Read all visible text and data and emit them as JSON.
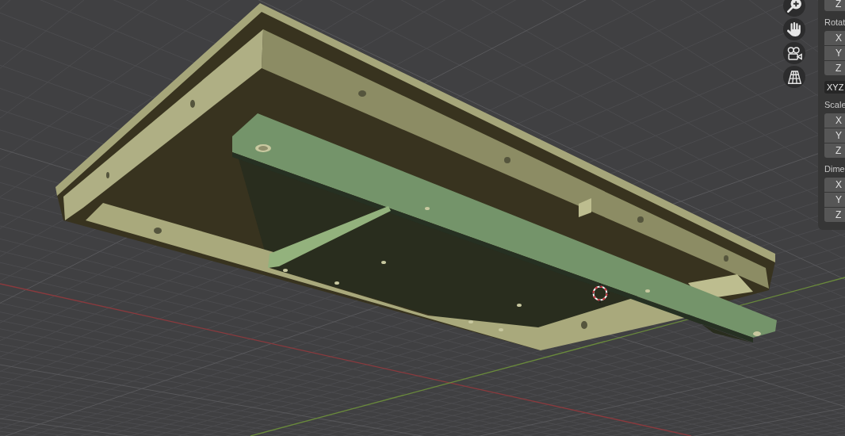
{
  "sidebar": {
    "location_tail": [
      {
        "label": "Z"
      }
    ],
    "groups": [
      {
        "heading": "Rotat",
        "fields": [
          {
            "label": "X"
          },
          {
            "label": "Y"
          },
          {
            "label": "Z"
          }
        ],
        "mode_dropdown": "XYZ"
      },
      {
        "heading": "Scale",
        "fields": [
          {
            "label": "X"
          },
          {
            "label": "Y"
          },
          {
            "label": "Z"
          }
        ]
      },
      {
        "heading": "Dime",
        "fields": [
          {
            "label": "X"
          },
          {
            "label": "Y"
          },
          {
            "label": "Z"
          }
        ]
      }
    ]
  }
}
